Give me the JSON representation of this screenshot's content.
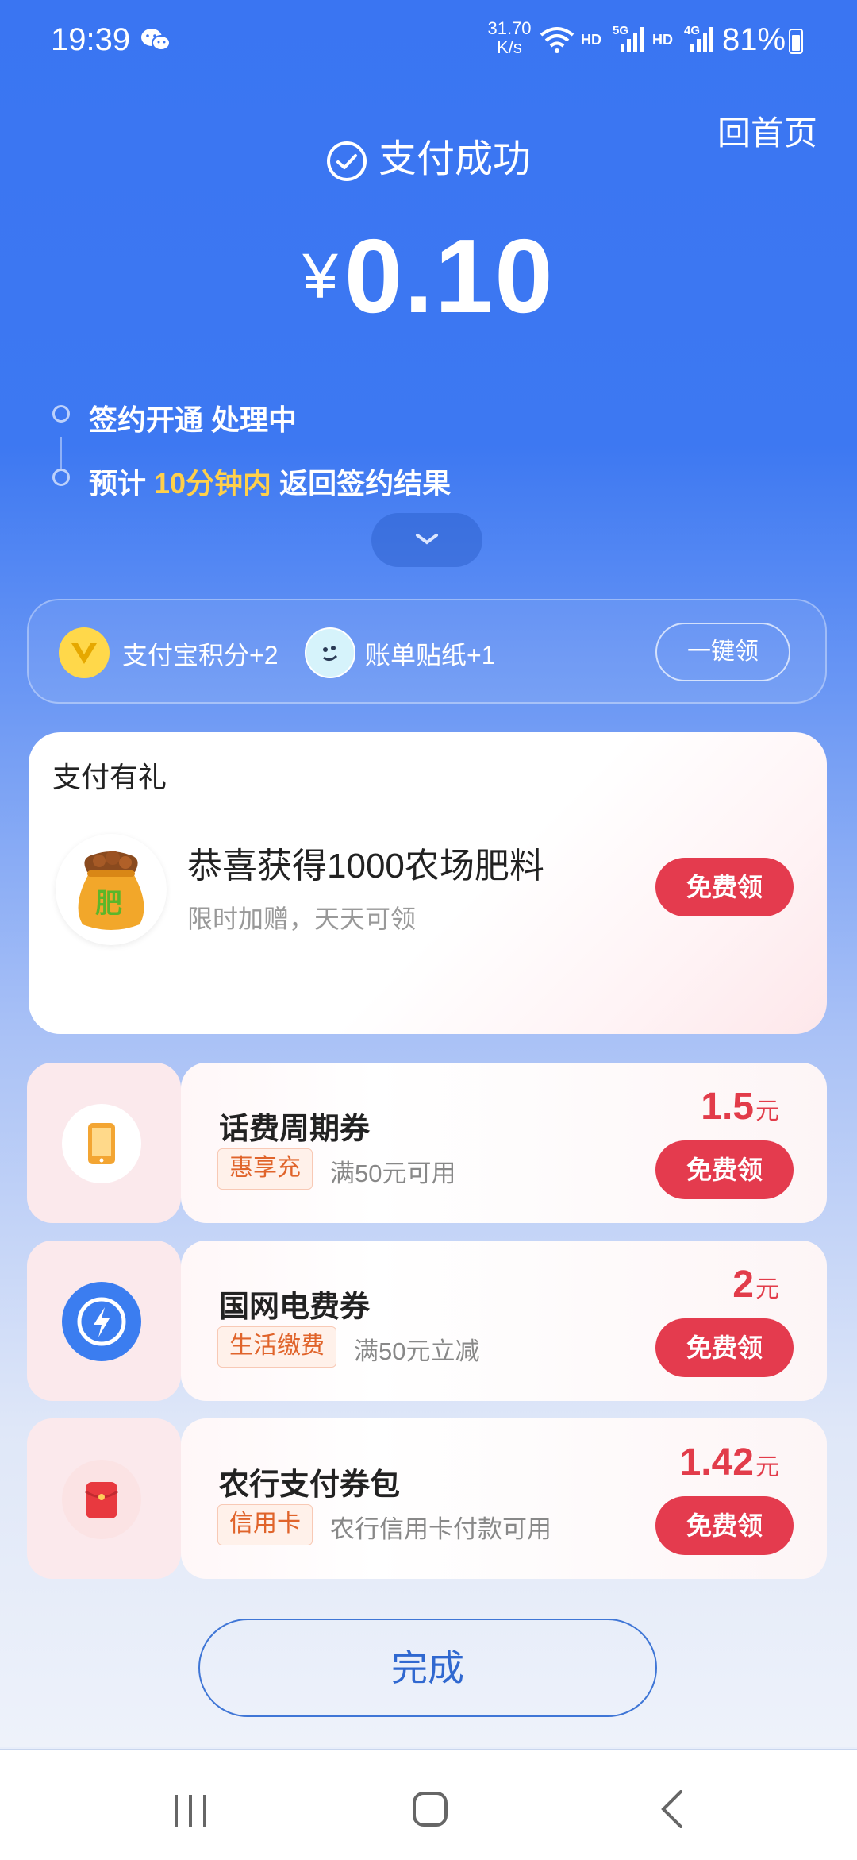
{
  "status_bar": {
    "time": "19:39",
    "speed_value": "31.70",
    "speed_unit": "K/s",
    "hd1": "HD",
    "net1": "5G",
    "hd2": "HD",
    "net2": "4G",
    "battery": "81%"
  },
  "header": {
    "home_link": "回首页",
    "title": "支付成功",
    "currency": "¥",
    "amount": "0.10"
  },
  "timeline": {
    "step1": "签约开通 处理中",
    "step2_prefix": "预计 ",
    "step2_highlight": "10分钟内",
    "step2_suffix": " 返回签约结果"
  },
  "rewards": {
    "points": "支付宝积分+2",
    "sticker": "账单贴纸+1",
    "claim_all": "一键领"
  },
  "gift": {
    "section_title": "支付有礼",
    "sack_char": "肥",
    "main": "恭喜获得1000农场肥料",
    "sub": "限时加赠，天天可领",
    "button": "免费领"
  },
  "coupons": [
    {
      "name": "话费周期券",
      "tag": "惠享充",
      "desc": "满50元可用",
      "value": "1.5",
      "unit": "元",
      "button": "免费领",
      "icon": "phone-icon"
    },
    {
      "name": "国网电费券",
      "tag": "生活缴费",
      "desc": "满50元立减",
      "value": "2",
      "unit": "元",
      "button": "免费领",
      "icon": "lightning-icon"
    },
    {
      "name": "农行支付券包",
      "tag": "信用卡",
      "desc": "农行信用卡付款可用",
      "value": "1.42",
      "unit": "元",
      "button": "免费领",
      "icon": "red-envelope-icon"
    }
  ],
  "done_button": "完成",
  "colors": {
    "primary_blue": "#3a75f2",
    "red_button": "#e43b4e",
    "highlight_yellow": "#ffd04a"
  }
}
